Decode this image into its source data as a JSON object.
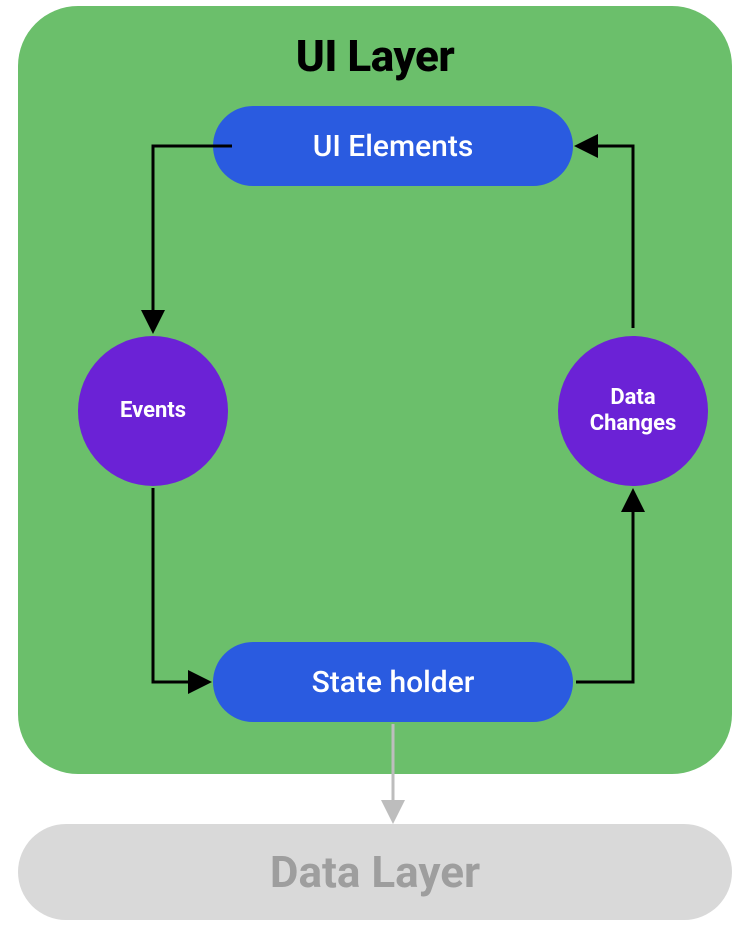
{
  "diagram": {
    "title": "UI Layer",
    "nodes": {
      "ui_elements": "UI Elements",
      "state_holder": "State holder",
      "events": "Events",
      "data_changes": "Data\nChanges",
      "data_layer": "Data Layer"
    },
    "colors": {
      "layer_bg": "#6bbf6b",
      "pill": "#2a5be0",
      "circle": "#6b22d6",
      "data_layer_bg": "#d9d9d9",
      "data_layer_text": "#9e9e9e",
      "arrow": "#000000",
      "arrow_muted": "#bdbdbd"
    },
    "flow": [
      {
        "from": "ui_elements",
        "to": "events"
      },
      {
        "from": "events",
        "to": "state_holder"
      },
      {
        "from": "state_holder",
        "to": "data_changes"
      },
      {
        "from": "data_changes",
        "to": "ui_elements"
      },
      {
        "from": "state_holder",
        "to": "data_layer"
      }
    ]
  }
}
